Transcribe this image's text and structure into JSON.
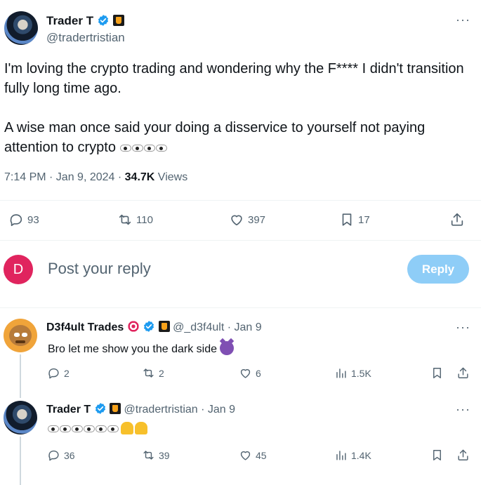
{
  "main_tweet": {
    "author_name": "Trader T",
    "author_handle": "@tradertristian",
    "more": "···",
    "text_line1": "I'm loving the crypto trading and wondering why the F**** I didn't transition fully long time ago.",
    "text_line2": "A wise man once said your doing a disservice to yourself not paying attention to crypto",
    "time": "7:14 PM · Jan 9, 2024 · ",
    "views_count": "34.7K",
    "views_label": " Views",
    "replies": "93",
    "retweets": "110",
    "likes": "397",
    "bookmarks": "17"
  },
  "compose": {
    "avatar_letter": "D",
    "placeholder": "Post your reply",
    "button": "Reply"
  },
  "replies": [
    {
      "author_name": "D3f4ult Trades",
      "author_handle": "@_d3f4ult",
      "date": "· Jan 9",
      "text": "Bro let me show you the dark side",
      "replies": "2",
      "retweets": "2",
      "likes": "6",
      "views": "1.5K",
      "more": "···"
    },
    {
      "author_name": "Trader T",
      "author_handle": "@tradertristian",
      "date": "· Jan 9",
      "text": "",
      "replies": "36",
      "retweets": "39",
      "likes": "45",
      "views": "1.4K",
      "more": "···"
    }
  ],
  "colors": {
    "accent": "#1d9bf0",
    "reply_button": "#8ecdf7",
    "avatar_d": "#e0245e",
    "secondary_text": "#536471"
  }
}
